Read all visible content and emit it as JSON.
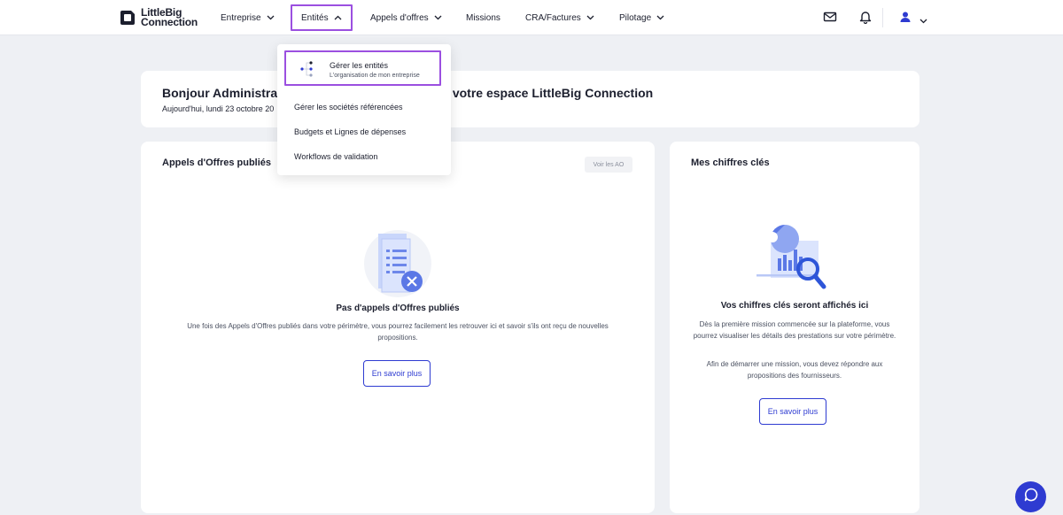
{
  "brand": {
    "line1": "LittleBig",
    "line2": "Connection"
  },
  "nav": [
    {
      "label": "Entreprise",
      "chevron": "chevron-down-icon"
    },
    {
      "label": "Entités",
      "chevron": "chevron-up-icon"
    },
    {
      "label": "Appels d'offres",
      "chevron": "chevron-down-icon"
    },
    {
      "label": "Missions",
      "chevron": ""
    },
    {
      "label": "CRA/Factures",
      "chevron": "chevron-down-icon"
    },
    {
      "label": "Pilotage",
      "chevron": "chevron-down-icon"
    }
  ],
  "icons": {
    "mail": "mail-icon",
    "bell": "bell-icon",
    "user": "user-icon",
    "chat": "chat-icon"
  },
  "welcome": {
    "title_left": "Bonjour Administra",
    "title_right": "sur votre espace LittleBig Connection",
    "subtitle": "Aujourd'hui, lundi 23 octobre 20"
  },
  "dropdown": {
    "items": [
      {
        "label": "Gérer les entités",
        "sublabel": "L'organisation de mon entreprise"
      },
      {
        "label": "Gérer les sociétés référencées"
      },
      {
        "label": "Budgets et Lignes de dépenses"
      },
      {
        "label": "Workflows de validation"
      }
    ]
  },
  "ao_card": {
    "title": "Appels d'Offres publiés",
    "see_all": "Voir les AO",
    "empty_title": "Pas d'appels d'Offres publiés",
    "empty_text": "Une fois des Appels d'Offres publiés dans votre périmètre, vous pourrez facilement les retrouver ici et savoir s'ils ont reçu de nouvelles propositions.",
    "button": "En savoir plus"
  },
  "kpi_card": {
    "title": "Mes chiffres clés",
    "empty_title": "Vos chiffres clés seront affichés ici",
    "text1": "Dès la première mission commencée sur la plateforme, vous pourrez visualiser les détails des prestations sur votre périmètre.",
    "text2": "Afin de démarrer une mission, vous devez répondre aux propositions des fournisseurs.",
    "button": "En savoir plus"
  },
  "colors": {
    "accent": "#2e3bd1",
    "highlight": "#9b4fe0",
    "background": "#eef0f4"
  }
}
